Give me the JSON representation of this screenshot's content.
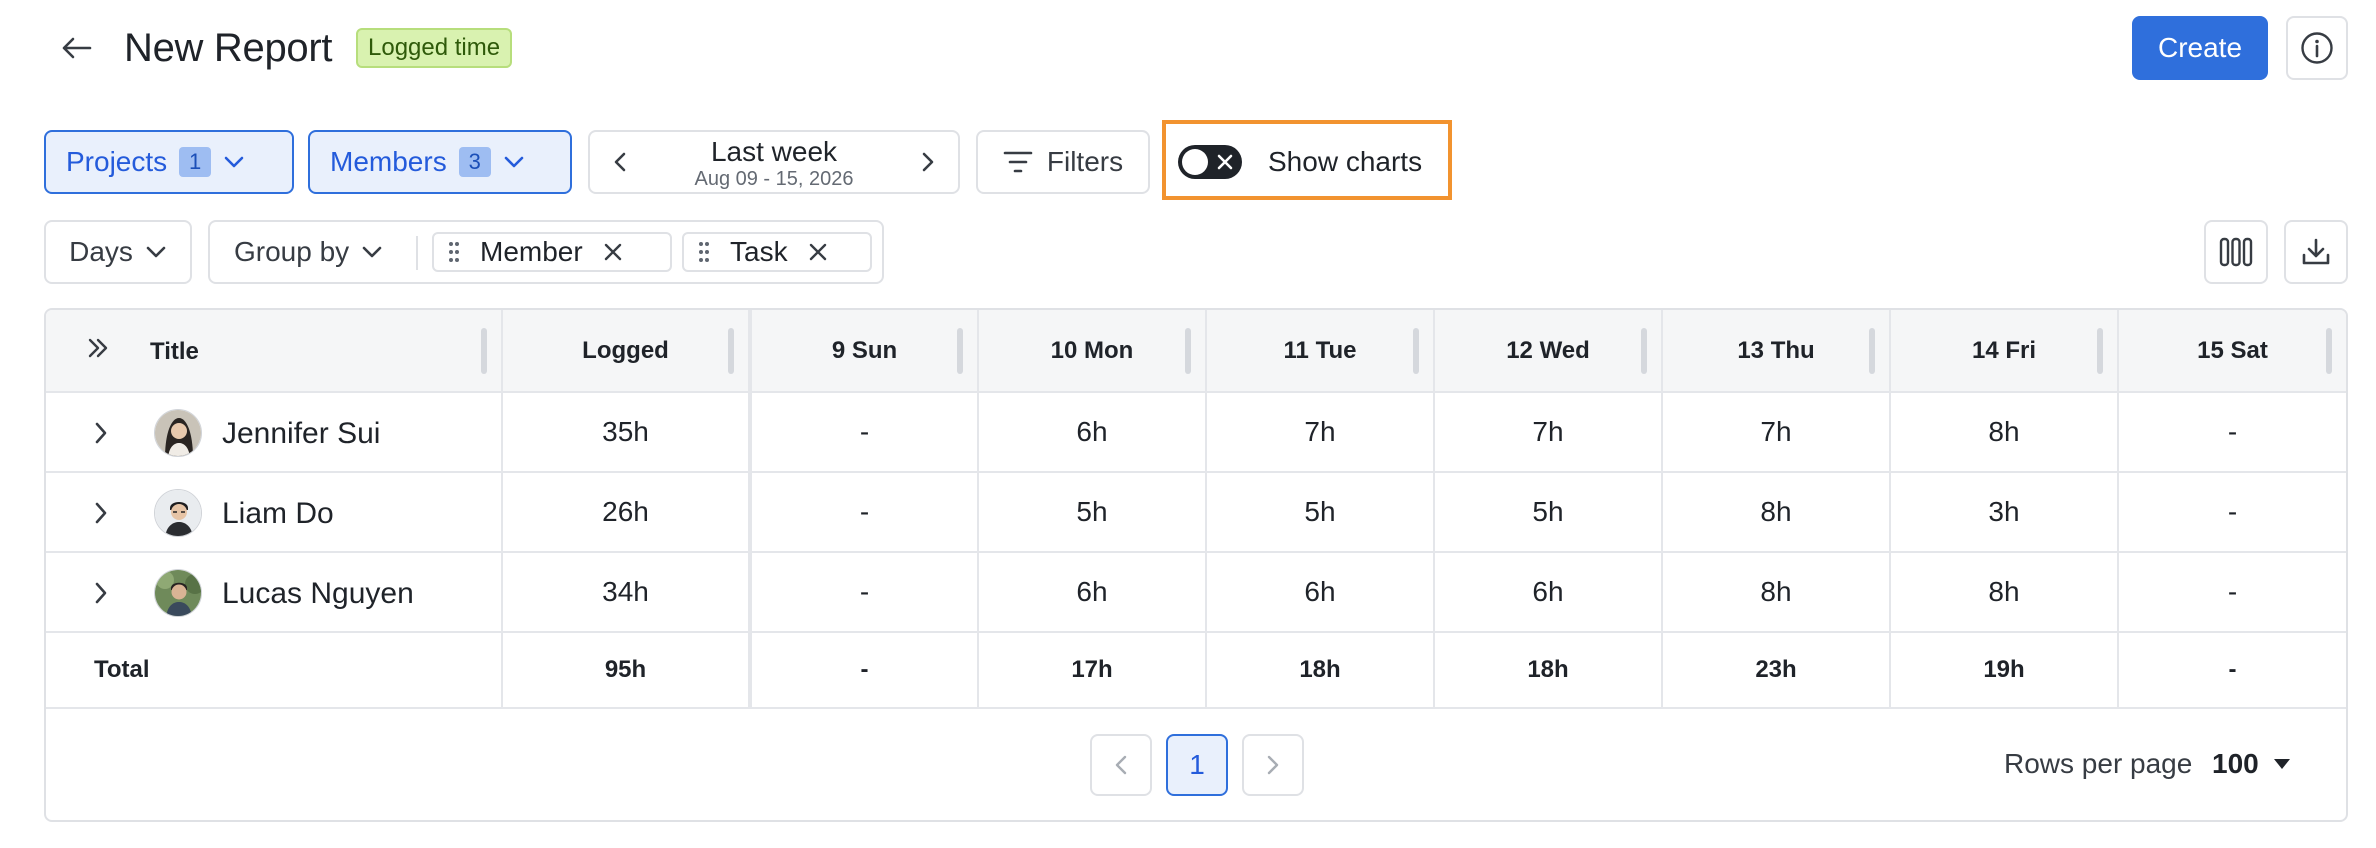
{
  "header": {
    "title": "New Report",
    "badge": "Logged time",
    "create_label": "Create"
  },
  "filters": {
    "projects": {
      "label": "Projects",
      "count": "1"
    },
    "members": {
      "label": "Members",
      "count": "3"
    },
    "date_range": {
      "label": "Last week",
      "sub": "Aug 09 - 15, 2026"
    },
    "filters_label": "Filters",
    "show_charts": {
      "label": "Show charts",
      "enabled": false
    }
  },
  "grouping": {
    "period": "Days",
    "group_by_label": "Group by",
    "groups": [
      "Member",
      "Task"
    ]
  },
  "table": {
    "columns": [
      "Title",
      "Logged",
      "9 Sun",
      "10 Mon",
      "11 Tue",
      "12 Wed",
      "13 Thu",
      "14 Fri",
      "15 Sat"
    ],
    "rows": [
      {
        "name": "Jennifer Sui",
        "cells": [
          "35h",
          "-",
          "6h",
          "7h",
          "7h",
          "7h",
          "8h",
          "-"
        ]
      },
      {
        "name": "Liam Do",
        "cells": [
          "26h",
          "-",
          "5h",
          "5h",
          "5h",
          "8h",
          "3h",
          "-"
        ]
      },
      {
        "name": "Lucas Nguyen",
        "cells": [
          "34h",
          "-",
          "6h",
          "6h",
          "6h",
          "8h",
          "8h",
          "-"
        ]
      }
    ],
    "total": {
      "label": "Total",
      "cells": [
        "95h",
        "-",
        "17h",
        "18h",
        "18h",
        "23h",
        "19h",
        "-"
      ]
    }
  },
  "pagination": {
    "current_page": "1",
    "rows_per_page_label": "Rows per page",
    "rows_per_page": "100"
  },
  "colors": {
    "primary": "#2f6fdc",
    "highlight": "#f2932f",
    "badge_bg": "#d9f2b0"
  }
}
